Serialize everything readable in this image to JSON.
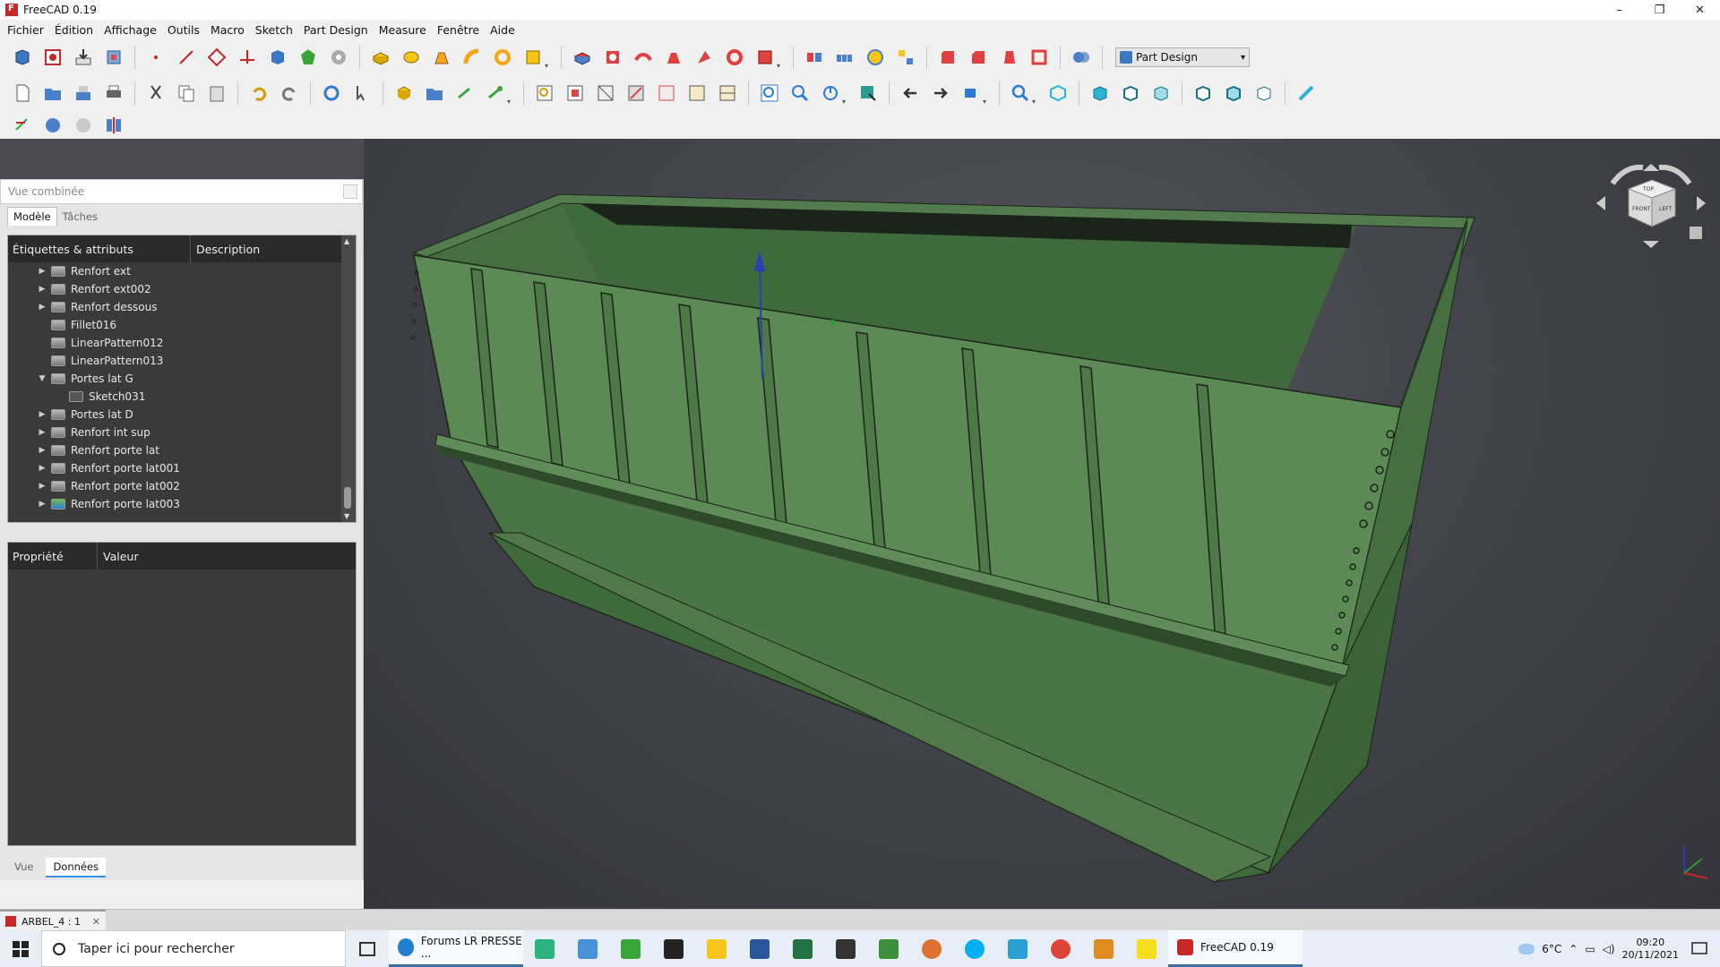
{
  "window": {
    "title": "FreeCAD 0.19",
    "controls": [
      "–",
      "❐",
      "✕"
    ]
  },
  "menu": [
    "Fichier",
    "Édition",
    "Affichage",
    "Outils",
    "Macro",
    "Sketch",
    "Part Design",
    "Measure",
    "Fenêtre",
    "Aide"
  ],
  "toolbar": {
    "workbench": "Part Design"
  },
  "combo_view": {
    "title": "Vue combinée",
    "tabs": [
      "Modèle",
      "Tâches"
    ],
    "tree_header": {
      "labels": "Étiquettes & attributs",
      "description": "Description"
    },
    "tree_items": [
      {
        "label": "Renfort ext",
        "expand": "▶",
        "icon": "body-icon"
      },
      {
        "label": "Renfort ext002",
        "expand": "▶",
        "icon": "body-icon"
      },
      {
        "label": "Renfort dessous",
        "expand": "▶",
        "icon": "body-icon"
      },
      {
        "label": "Fillet016",
        "expand": "",
        "icon": "fillet-icon"
      },
      {
        "label": "LinearPattern012",
        "expand": "",
        "icon": "pattern-icon"
      },
      {
        "label": "LinearPattern013",
        "expand": "",
        "icon": "pattern-icon"
      },
      {
        "label": "Portes lat G",
        "expand": "▼",
        "icon": "body-icon"
      },
      {
        "label": "Sketch031",
        "expand": "",
        "icon": "sketch-icon",
        "child": true
      },
      {
        "label": "Portes lat D",
        "expand": "▶",
        "icon": "body-icon"
      },
      {
        "label": "Renfort int sup",
        "expand": "▶",
        "icon": "body-icon"
      },
      {
        "label": "Renfort porte lat",
        "expand": "▶",
        "icon": "body-icon"
      },
      {
        "label": "Renfort porte lat001",
        "expand": "▶",
        "icon": "body-icon"
      },
      {
        "label": "Renfort porte lat002",
        "expand": "▶",
        "icon": "body-icon"
      },
      {
        "label": "Renfort porte lat003",
        "expand": "▶",
        "icon": "body-active-icon"
      }
    ],
    "prop_header": {
      "property": "Propriété",
      "value": "Valeur"
    },
    "bottom_tabs": [
      "Vue",
      "Données"
    ]
  },
  "document_tab": {
    "label": "ARBEL_4 : 1",
    "close": "✕"
  },
  "taskbar": {
    "search_placeholder": "Taper ici pour rechercher",
    "edge_label": "Forums LR PRESSE ...",
    "freecad_label": "FreeCAD 0.19",
    "temperature": "6°C",
    "time": "09:20",
    "date": "20/11/2021"
  },
  "colors": {
    "model_green": "#4f7a4a",
    "model_dark": "#1d2a1c",
    "viewport_bg": "#45454d"
  }
}
